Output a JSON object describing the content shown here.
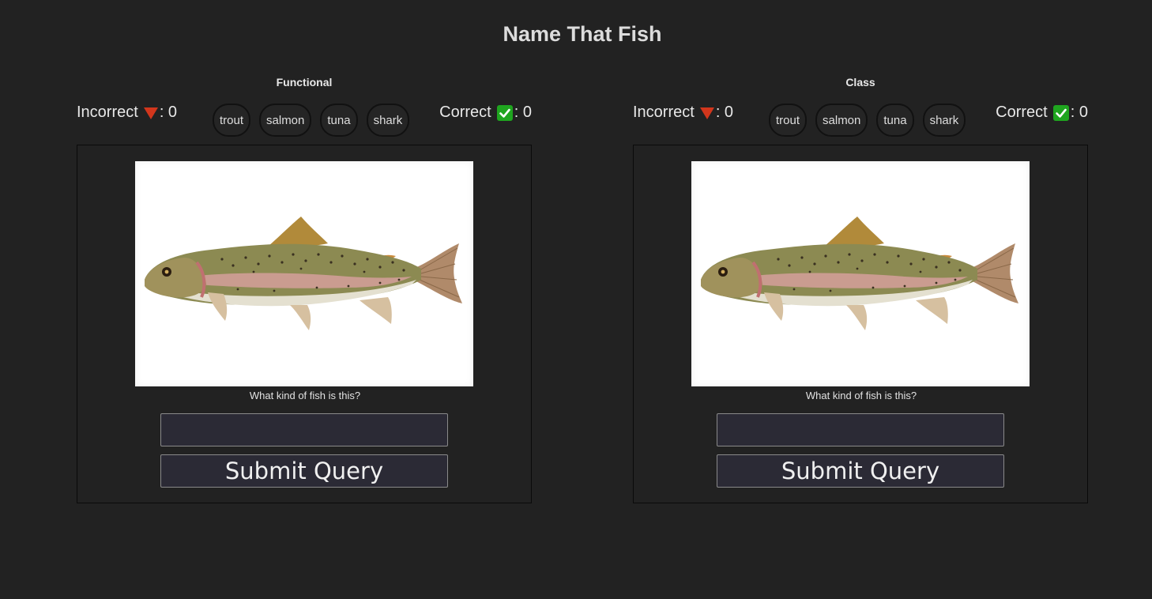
{
  "page": {
    "title": "Name That Fish"
  },
  "panels": [
    {
      "title": "Functional",
      "incorrect_label": "Incorrect",
      "incorrect_count": ": 0",
      "correct_label": "Correct",
      "correct_count": ": 0",
      "choices": [
        "trout",
        "salmon",
        "tuna",
        "shark"
      ],
      "question": "What kind of fish is this?",
      "answer_value": "",
      "submit_label": "Submit Query"
    },
    {
      "title": "Class",
      "incorrect_label": "Incorrect",
      "incorrect_count": ": 0",
      "correct_label": "Correct",
      "correct_count": ": 0",
      "choices": [
        "trout",
        "salmon",
        "tuna",
        "shark"
      ],
      "question": "What kind of fish is this?",
      "answer_value": "",
      "submit_label": "Submit Query"
    }
  ],
  "icons": {
    "incorrect": "red-triangle-down-icon",
    "correct": "green-checkmark-icon"
  },
  "colors": {
    "background": "#222222",
    "incorrect": "#d2361c",
    "correct": "#1fa51f",
    "input_bg": "#2b2a35"
  }
}
